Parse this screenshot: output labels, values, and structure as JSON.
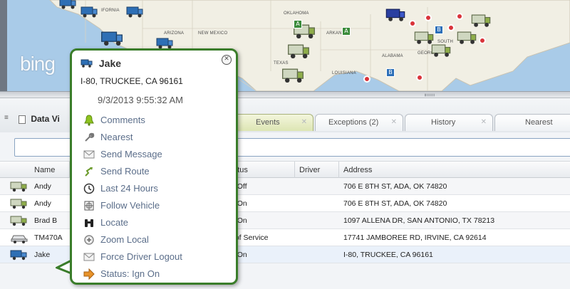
{
  "map": {
    "brand": "bing",
    "state_labels": [
      "OKLAHOMA",
      "ARIZONA",
      "NEW MEXICO",
      "TEXAS",
      "ARKANSAS",
      "ALABAMA",
      "LOUISIANA",
      "SOUTH",
      "GEORGIA",
      "IFORNIA"
    ]
  },
  "panel": {
    "title": "Data Vi",
    "tabs": [
      {
        "label": "Events",
        "active": true
      },
      {
        "label": "Exceptions (2)",
        "active": false
      },
      {
        "label": "History",
        "active": false
      },
      {
        "label": "Nearest",
        "active": false
      }
    ],
    "search_value": ""
  },
  "grid": {
    "columns": [
      "Name",
      "tatus",
      "Driver",
      "Address"
    ],
    "rows": [
      {
        "name": "Andy",
        "status": "n Off",
        "driver": "",
        "address": "706 E 8TH ST, ADA, OK 74820",
        "icon": "truck-icon"
      },
      {
        "name": "Andy",
        "status": "n On",
        "driver": "",
        "address": "706 E 8TH ST, ADA, OK 74820",
        "icon": "truck-icon"
      },
      {
        "name": "Brad B",
        "status": "n On",
        "driver": "",
        "address": "1097 ALLENA DR, SAN ANTONIO, TX 78213",
        "icon": "truck-icon"
      },
      {
        "name": "TM470A",
        "status": "t of Service",
        "driver": "",
        "address": "17741 JAMBOREE RD, IRVINE, CA 92614",
        "icon": "car-icon"
      },
      {
        "name": "Jake",
        "status": "n On",
        "driver": "",
        "address": "I-80, TRUCKEE, CA 96161",
        "icon": "blue-truck-icon"
      }
    ]
  },
  "popup": {
    "title": "Jake",
    "address": "I-80, TRUCKEE, CA 96161",
    "timestamp": "9/3/2013 9:55:32 AM",
    "menu": [
      {
        "label": "Comments",
        "icon": "bell-icon"
      },
      {
        "label": "Nearest",
        "icon": "wrench-icon"
      },
      {
        "label": "Send Message",
        "icon": "envelope-icon"
      },
      {
        "label": "Send Route",
        "icon": "route-icon"
      },
      {
        "label": "Last 24 Hours",
        "icon": "clock-icon"
      },
      {
        "label": "Follow Vehicle",
        "icon": "follow-icon"
      },
      {
        "label": "Locate",
        "icon": "binoculars-icon"
      },
      {
        "label": "Zoom Local",
        "icon": "zoom-icon"
      },
      {
        "label": "Force Driver Logout",
        "icon": "envelope-icon"
      },
      {
        "label": "Status: Ign On",
        "icon": "arrow-right-icon"
      }
    ]
  },
  "colors": {
    "popup_border": "#3a7d2a",
    "menu_text": "#5b6e8a",
    "map_water": "#a9cbe8",
    "map_land": "#f1efe4",
    "pin": "#d9333a"
  }
}
